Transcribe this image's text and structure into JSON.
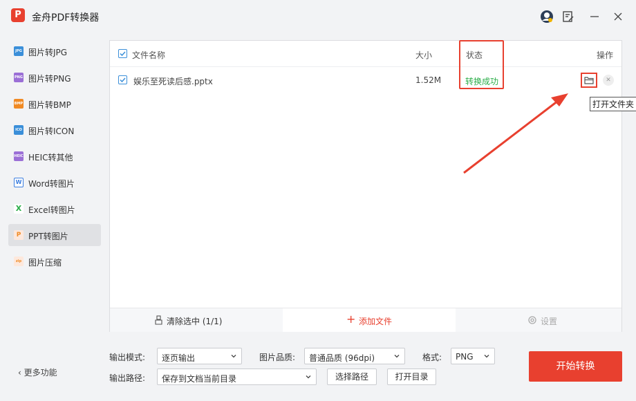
{
  "app": {
    "title": "金舟PDF转换器",
    "logo": "P"
  },
  "sidebar": {
    "items": [
      {
        "label": "图片转JPG",
        "icon": "JPG",
        "color": "#3b8fd9"
      },
      {
        "label": "图片转PNG",
        "icon": "PNG",
        "color": "#9b6fd6"
      },
      {
        "label": "图片转BMP",
        "icon": "BMP",
        "color": "#f08a24"
      },
      {
        "label": "图片转ICON",
        "icon": "ICO",
        "color": "#3b8fd9"
      },
      {
        "label": "HEIC转其他",
        "icon": "HEIC",
        "color": "#9b6fd6"
      },
      {
        "label": "Word转图片",
        "icon": "W",
        "color": "#3b7ee0"
      },
      {
        "label": "Excel转图片",
        "icon": "X",
        "color": "#2cae4a"
      },
      {
        "label": "PPT转图片",
        "icon": "P",
        "color": "#f08a24"
      },
      {
        "label": "图片压缩",
        "icon": "zip",
        "color": "#f08a24"
      }
    ],
    "more": "更多功能"
  },
  "table": {
    "headers": {
      "name": "文件名称",
      "size": "大小",
      "status": "状态",
      "action": "操作"
    },
    "rows": [
      {
        "name": "娱乐至死读后感.pptx",
        "size": "1.52M",
        "status": "转换成功"
      }
    ],
    "tooltip": "打开文件夹"
  },
  "bottombar": {
    "clear": "清除选中 (1/1)",
    "add": "添加文件",
    "settings": "设置"
  },
  "options": {
    "mode_label": "输出模式:",
    "mode_value": "逐页输出",
    "quality_label": "图片品质:",
    "quality_value": "普通品质 (96dpi)",
    "format_label": "格式:",
    "format_value": "PNG",
    "path_label": "输出路径:",
    "path_value": "保存到文档当前目录",
    "choose_path": "选择路径",
    "open_dir": "打开目录",
    "start": "开始转换"
  },
  "colors": {
    "accent": "#e8402f",
    "success": "#2cae4a",
    "check": "#3b8fd9"
  }
}
